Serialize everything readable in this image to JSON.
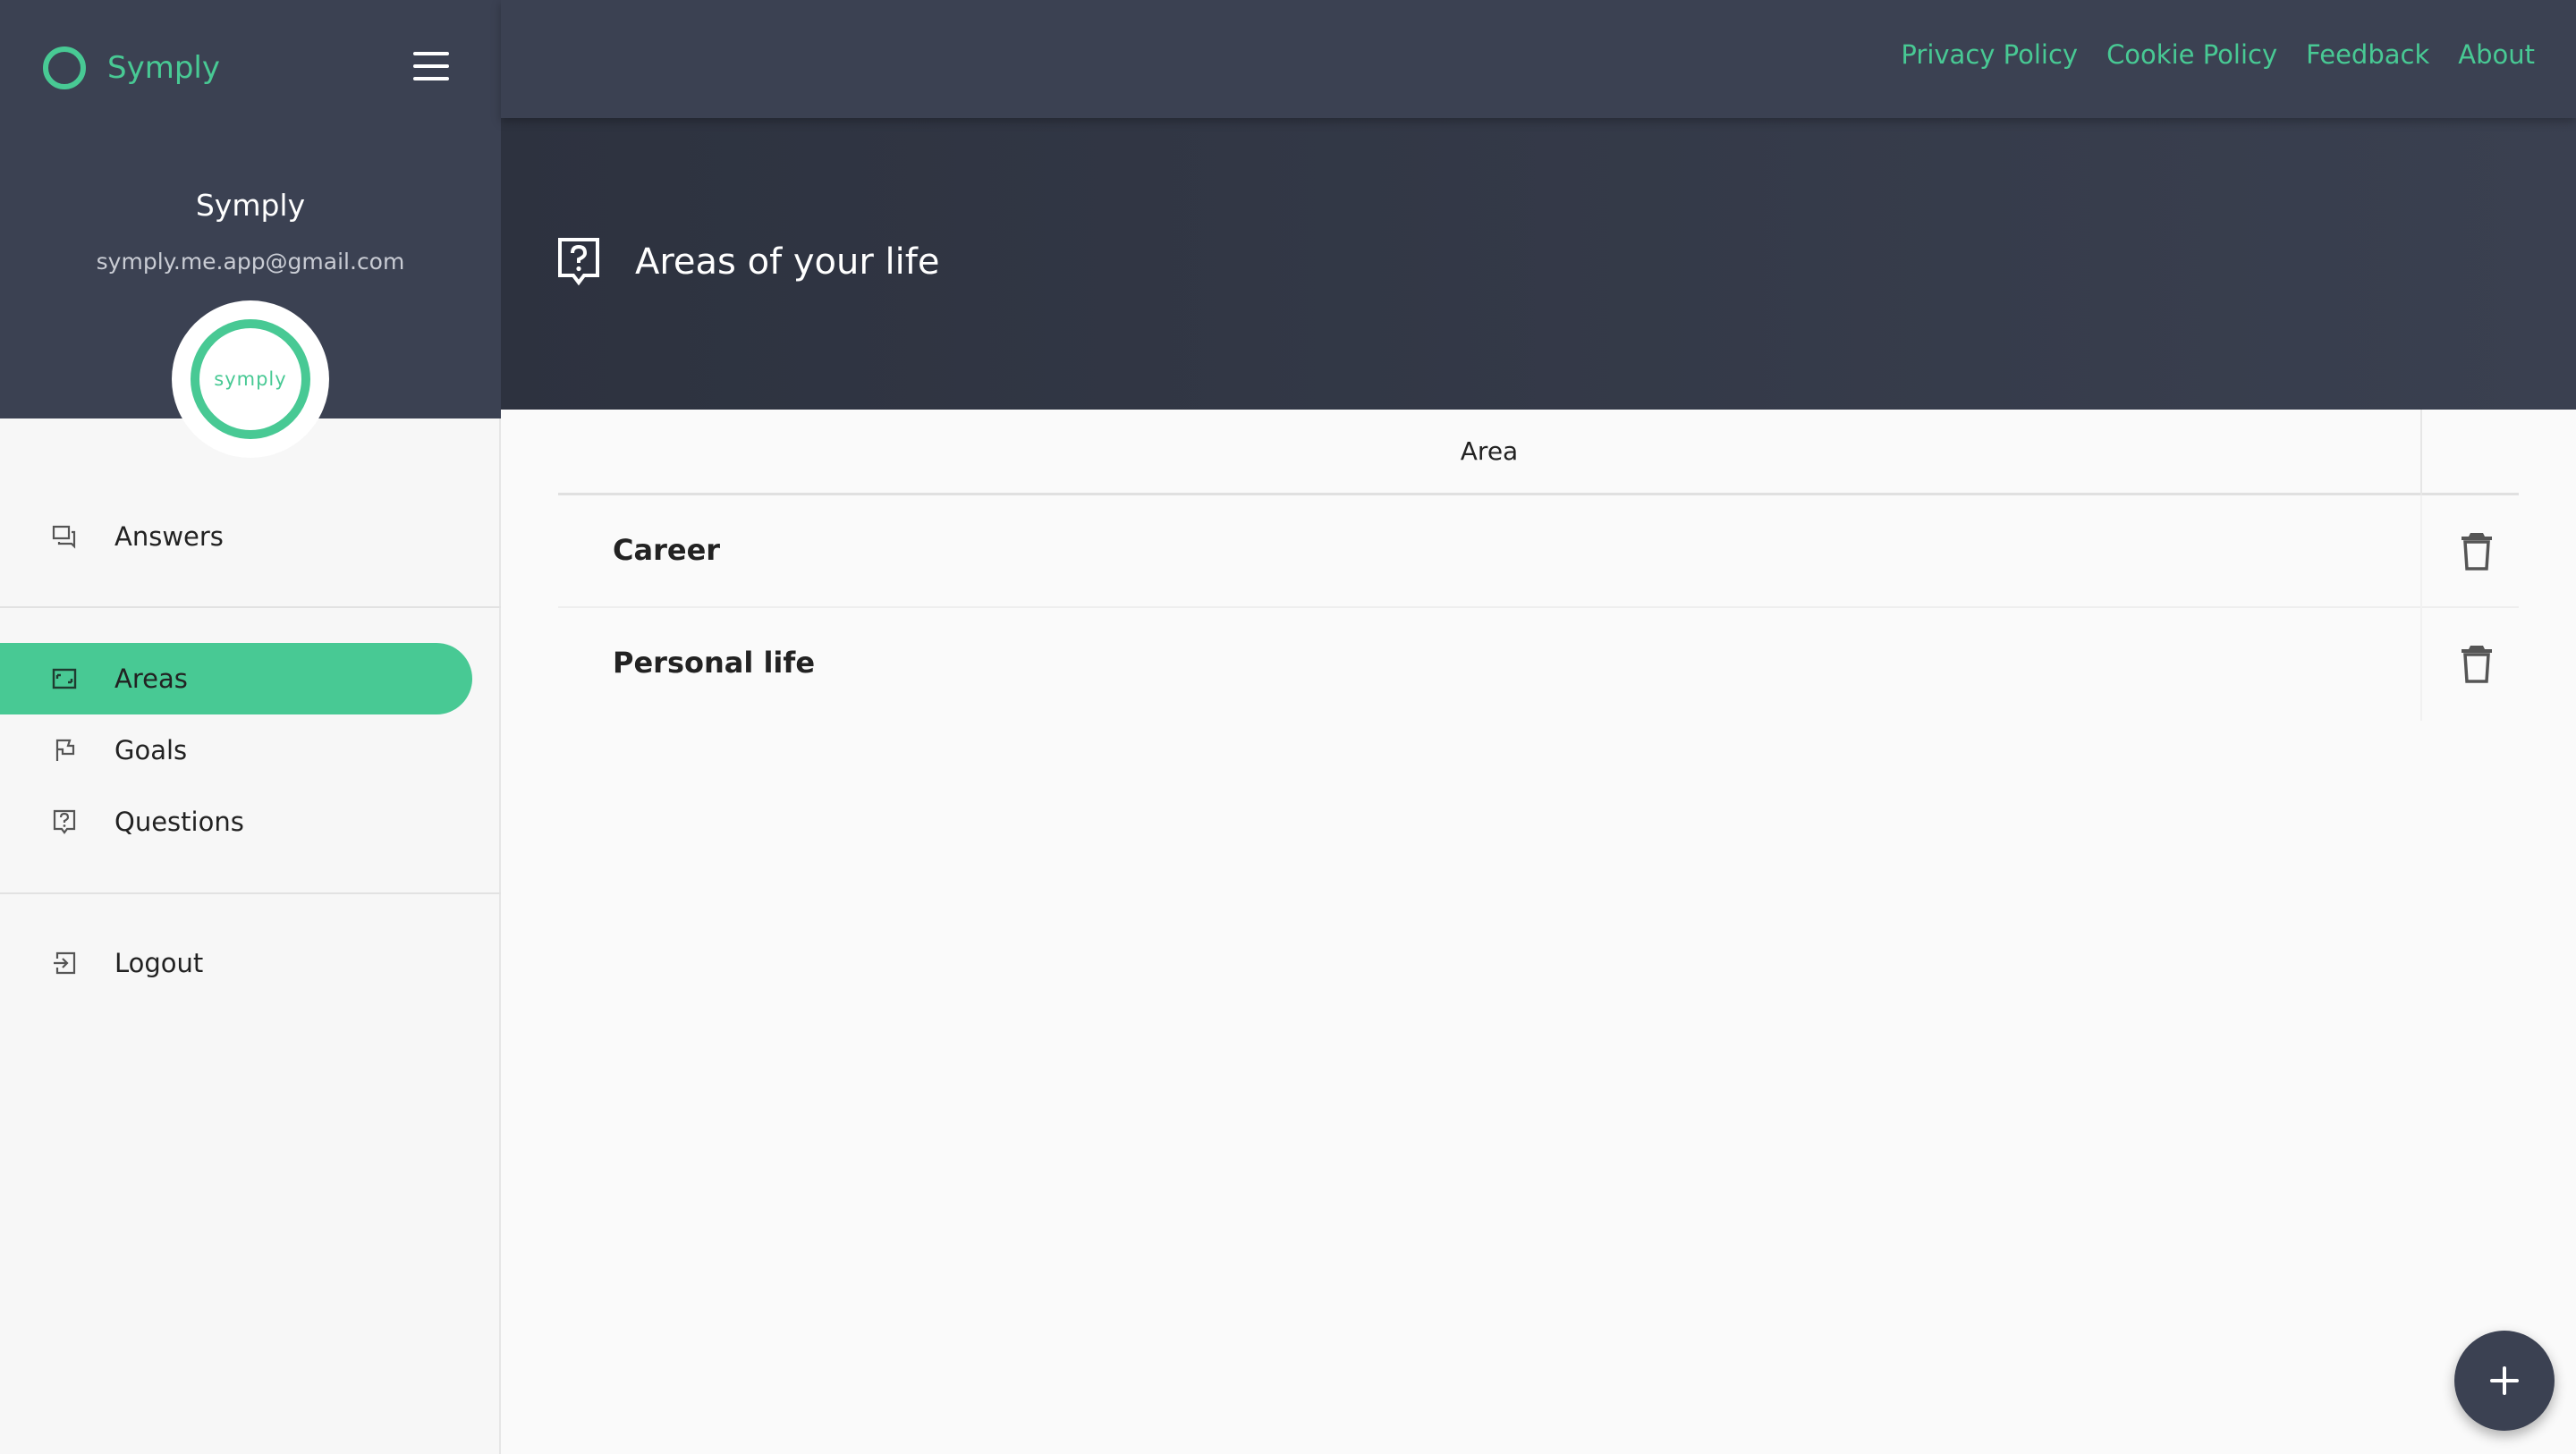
{
  "app": {
    "brand_name": "Symply",
    "logo_text": "symply"
  },
  "user": {
    "name": "Symply",
    "email": "symply.me.app@gmail.com"
  },
  "sidebar": {
    "items": [
      {
        "label": "Answers",
        "icon": "chat-icon"
      },
      {
        "label": "Areas",
        "icon": "image-frame-icon",
        "active": true
      },
      {
        "label": "Goals",
        "icon": "flag-icon"
      },
      {
        "label": "Questions",
        "icon": "question-bubble-icon"
      }
    ],
    "logout": {
      "label": "Logout",
      "icon": "logout-icon"
    }
  },
  "topbar": {
    "links": [
      "Privacy Policy",
      "Cookie Policy",
      "Feedback",
      "About"
    ]
  },
  "page": {
    "title": "Areas of your life",
    "icon": "question-bubble-icon"
  },
  "table": {
    "column": "Area",
    "rows": [
      {
        "label": "Career"
      },
      {
        "label": "Personal life"
      }
    ]
  },
  "fab": {
    "icon": "plus-icon"
  },
  "colors": {
    "accent": "#48c994",
    "header": "#3b4152",
    "header_dark": "#2d323f"
  }
}
